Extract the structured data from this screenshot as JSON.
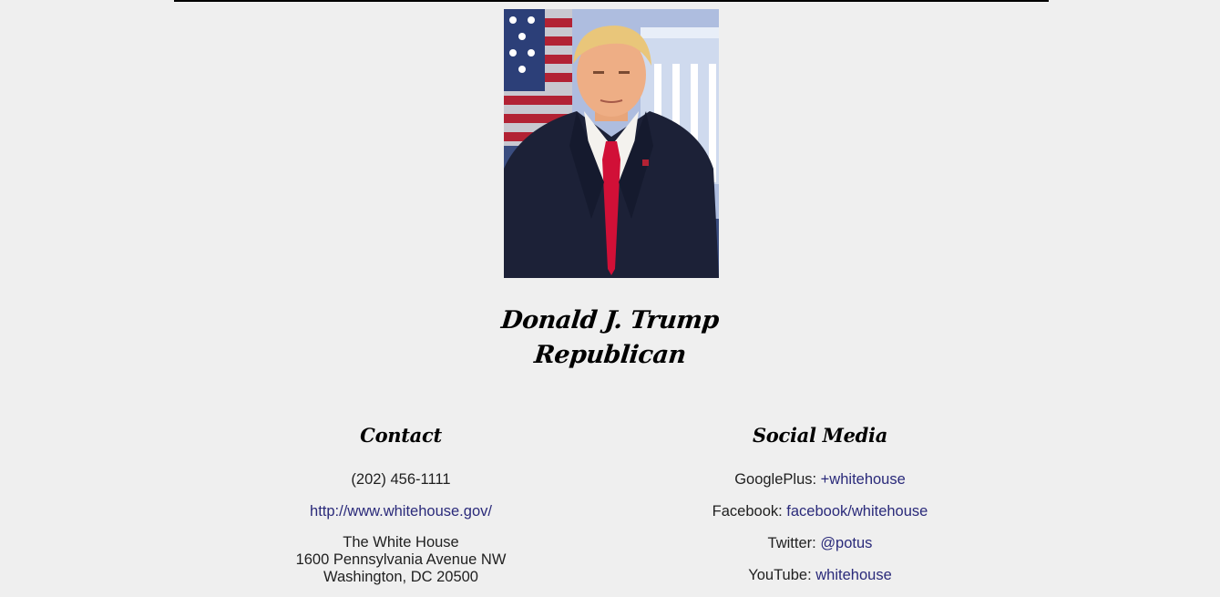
{
  "profile": {
    "name": "Donald J. Trump",
    "party": "Republican",
    "portrait_alt": "Official portrait"
  },
  "contact": {
    "heading": "Contact",
    "phone": "(202) 456-1111",
    "website": "http://www.whitehouse.gov/",
    "address_line1": "The White House",
    "address_line2": "1600 Pennsylvania Avenue NW",
    "address_line3": "Washington, DC 20500"
  },
  "social": {
    "heading": "Social Media",
    "googleplus_label": "GooglePlus:",
    "googleplus_value": "+whitehouse",
    "facebook_label": "Facebook:",
    "facebook_value": "facebook/whitehouse",
    "twitter_label": "Twitter:",
    "twitter_value": "@potus",
    "youtube_label": "YouTube:",
    "youtube_value": "whitehouse"
  },
  "colors": {
    "background": "#efefef",
    "link": "#2a2a7a",
    "text": "#1f1f1f",
    "rule": "#000000"
  }
}
